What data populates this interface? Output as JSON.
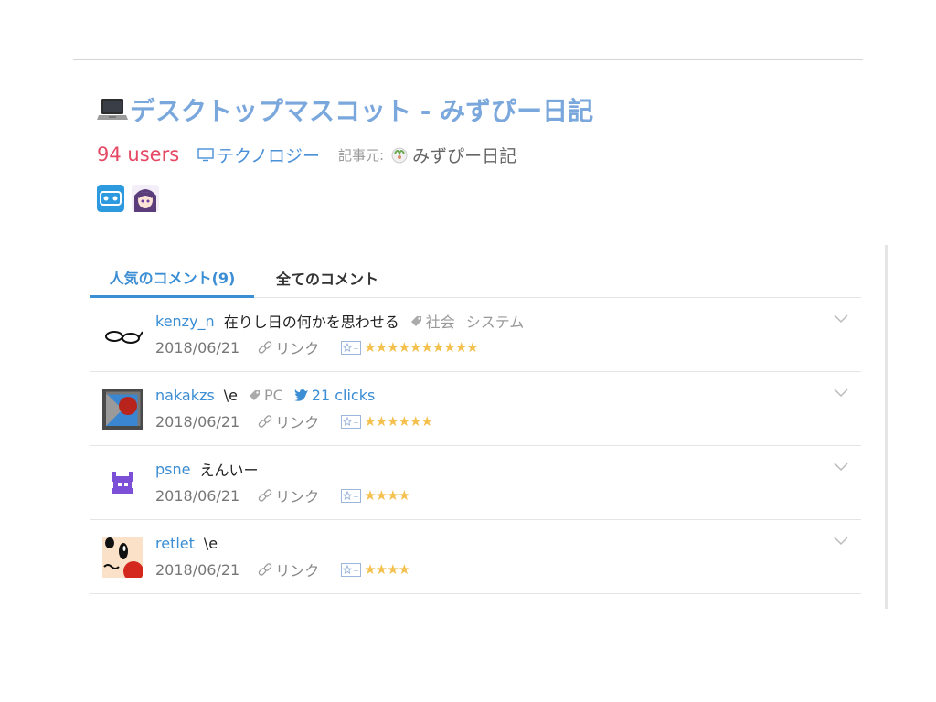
{
  "entry": {
    "title": "デスクトップマスコット - みずぴー日記",
    "users": "94 users",
    "category": "テクノロジー",
    "source_prefix": "記事元:",
    "source_name": "みずぴー日記",
    "badges": [
      "bookmark-app-badge",
      "anime-character-badge"
    ]
  },
  "tabs": {
    "popular": "人気のコメント(9)",
    "all": "全てのコメント"
  },
  "comments": [
    {
      "user": "kenzy_n",
      "text": "在りし日の何かを思わせる",
      "tags": [
        "社会",
        "システム"
      ],
      "date": "2018/06/21",
      "link": "リンク",
      "stars": 10,
      "stars_text": "★★★★★★★★★★"
    },
    {
      "user": "nakakzs",
      "text": "\\e",
      "tags": [
        "PC"
      ],
      "clicks": "21 clicks",
      "date": "2018/06/21",
      "link": "リンク",
      "stars": 6,
      "stars_text": "★★★★★★"
    },
    {
      "user": "psne",
      "text": "えんいー",
      "date": "2018/06/21",
      "link": "リンク",
      "stars": 4,
      "stars_text": "★★★★"
    },
    {
      "user": "retlet",
      "text": "\\e",
      "date": "2018/06/21",
      "link": "リンク",
      "stars": 4,
      "stars_text": "★★★★"
    }
  ],
  "colors": {
    "title": "#7aa7dc",
    "users": "#e54964",
    "link_blue": "#3b8dd4",
    "star": "#f4c04e"
  }
}
